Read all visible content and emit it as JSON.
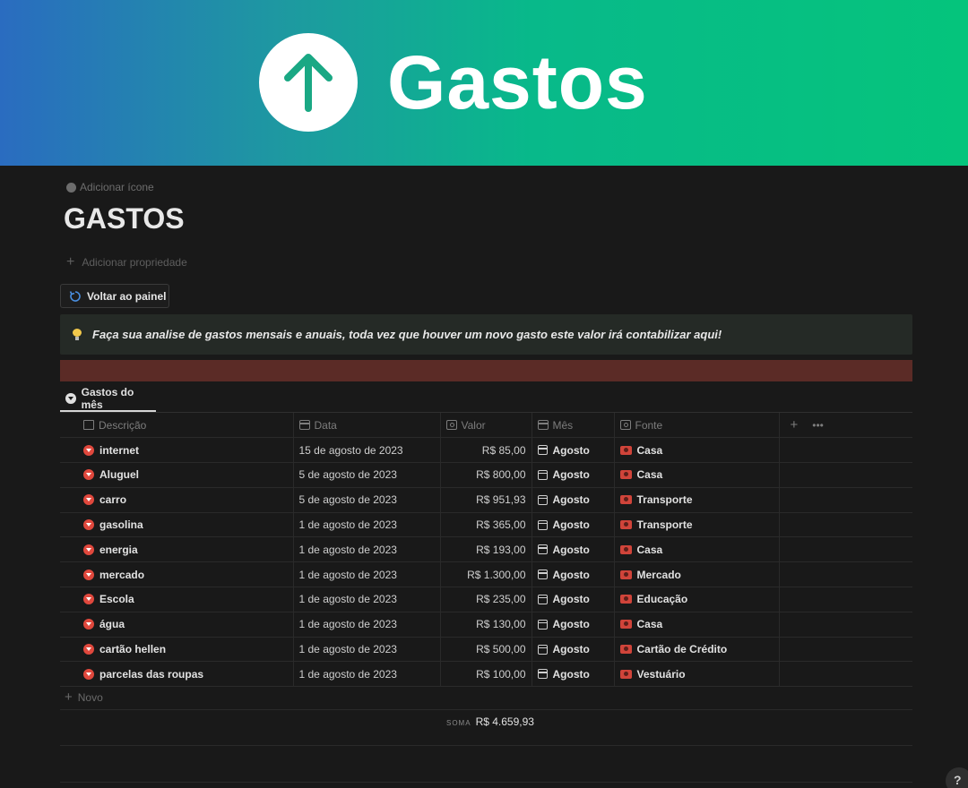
{
  "cover": {
    "title": "Gastos",
    "icon": "arrow-up-icon"
  },
  "page": {
    "add_icon_label": "Adicionar ícone",
    "title": "GASTOS",
    "add_property_label": "Adicionar propriedade",
    "back_button_label": "Voltar ao painel",
    "callout_text": "Faça sua analise de gastos mensais e anuais, toda vez que houver um novo gasto este valor irá contabilizar aqui!"
  },
  "view": {
    "tab_label": "Gastos do mês"
  },
  "table": {
    "columns": [
      "Descrição",
      "Data",
      "Valor",
      "Mês",
      "Fonte"
    ],
    "rows": [
      {
        "descricao": "internet",
        "data": "15 de agosto de 2023",
        "valor": "R$ 85,00",
        "mes": "Agosto",
        "fonte": "Casa"
      },
      {
        "descricao": "Aluguel",
        "data": "5 de agosto de 2023",
        "valor": "R$ 800,00",
        "mes": "Agosto",
        "fonte": "Casa"
      },
      {
        "descricao": "carro",
        "data": "5 de agosto de 2023",
        "valor": "R$ 951,93",
        "mes": "Agosto",
        "fonte": "Transporte"
      },
      {
        "descricao": "gasolina",
        "data": "1 de agosto de 2023",
        "valor": "R$ 365,00",
        "mes": "Agosto",
        "fonte": "Transporte"
      },
      {
        "descricao": "energia",
        "data": "1 de agosto de 2023",
        "valor": "R$ 193,00",
        "mes": "Agosto",
        "fonte": "Casa"
      },
      {
        "descricao": "mercado",
        "data": "1 de agosto de 2023",
        "valor": "R$ 1.300,00",
        "mes": "Agosto",
        "fonte": "Mercado"
      },
      {
        "descricao": "Escola",
        "data": "1 de agosto de 2023",
        "valor": "R$ 235,00",
        "mes": "Agosto",
        "fonte": "Educação"
      },
      {
        "descricao": "água",
        "data": "1 de agosto de 2023",
        "valor": "R$ 130,00",
        "mes": "Agosto",
        "fonte": "Casa"
      },
      {
        "descricao": "cartão hellen",
        "data": "1 de agosto de 2023",
        "valor": "R$ 500,00",
        "mes": "Agosto",
        "fonte": "Cartão de Crédito"
      },
      {
        "descricao": "parcelas das roupas",
        "data": "1 de agosto de 2023",
        "valor": "R$ 100,00",
        "mes": "Agosto",
        "fonte": "Vestuário"
      }
    ],
    "new_label": "Novo",
    "sum_label": "SOMA",
    "sum_value": "R$ 4.659,93"
  },
  "help_label": "?",
  "colors": {
    "accent_green": "#05c47c",
    "accent_blue": "#2a6cc0",
    "callout_bg": "#252a26",
    "red_bar": "#5b2b26",
    "expense_red": "#e0483d"
  }
}
